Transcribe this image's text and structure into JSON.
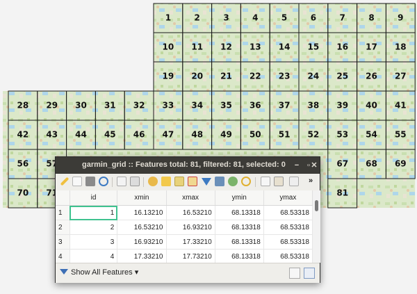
{
  "map": {
    "layer_name": "garmin_grid",
    "cells": [
      {
        "label": "1",
        "col": 5,
        "row": 0
      },
      {
        "label": "2",
        "col": 6,
        "row": 0
      },
      {
        "label": "3",
        "col": 7,
        "row": 0
      },
      {
        "label": "4",
        "col": 8,
        "row": 0
      },
      {
        "label": "5",
        "col": 9,
        "row": 0
      },
      {
        "label": "6",
        "col": 10,
        "row": 0
      },
      {
        "label": "7",
        "col": 11,
        "row": 0
      },
      {
        "label": "8",
        "col": 12,
        "row": 0
      },
      {
        "label": "9",
        "col": 13,
        "row": 0
      },
      {
        "label": "10",
        "col": 5,
        "row": 1
      },
      {
        "label": "11",
        "col": 6,
        "row": 1
      },
      {
        "label": "12",
        "col": 7,
        "row": 1
      },
      {
        "label": "13",
        "col": 8,
        "row": 1
      },
      {
        "label": "14",
        "col": 9,
        "row": 1
      },
      {
        "label": "15",
        "col": 10,
        "row": 1
      },
      {
        "label": "16",
        "col": 11,
        "row": 1
      },
      {
        "label": "17",
        "col": 12,
        "row": 1
      },
      {
        "label": "18",
        "col": 13,
        "row": 1
      },
      {
        "label": "19",
        "col": 5,
        "row": 2
      },
      {
        "label": "20",
        "col": 6,
        "row": 2
      },
      {
        "label": "21",
        "col": 7,
        "row": 2
      },
      {
        "label": "22",
        "col": 8,
        "row": 2
      },
      {
        "label": "23",
        "col": 9,
        "row": 2
      },
      {
        "label": "24",
        "col": 10,
        "row": 2
      },
      {
        "label": "25",
        "col": 11,
        "row": 2
      },
      {
        "label": "26",
        "col": 12,
        "row": 2
      },
      {
        "label": "27",
        "col": 13,
        "row": 2
      },
      {
        "label": "28",
        "col": 0,
        "row": 3
      },
      {
        "label": "29",
        "col": 1,
        "row": 3
      },
      {
        "label": "30",
        "col": 2,
        "row": 3
      },
      {
        "label": "31",
        "col": 3,
        "row": 3
      },
      {
        "label": "32",
        "col": 4,
        "row": 3
      },
      {
        "label": "33",
        "col": 5,
        "row": 3
      },
      {
        "label": "34",
        "col": 6,
        "row": 3
      },
      {
        "label": "35",
        "col": 7,
        "row": 3
      },
      {
        "label": "36",
        "col": 8,
        "row": 3
      },
      {
        "label": "37",
        "col": 9,
        "row": 3
      },
      {
        "label": "38",
        "col": 10,
        "row": 3
      },
      {
        "label": "39",
        "col": 11,
        "row": 3
      },
      {
        "label": "40",
        "col": 12,
        "row": 3
      },
      {
        "label": "41",
        "col": 13,
        "row": 3
      },
      {
        "label": "42",
        "col": 0,
        "row": 4
      },
      {
        "label": "43",
        "col": 1,
        "row": 4
      },
      {
        "label": "44",
        "col": 2,
        "row": 4
      },
      {
        "label": "45",
        "col": 3,
        "row": 4
      },
      {
        "label": "46",
        "col": 4,
        "row": 4
      },
      {
        "label": "47",
        "col": 5,
        "row": 4
      },
      {
        "label": "48",
        "col": 6,
        "row": 4
      },
      {
        "label": "49",
        "col": 7,
        "row": 4
      },
      {
        "label": "50",
        "col": 8,
        "row": 4
      },
      {
        "label": "51",
        "col": 9,
        "row": 4
      },
      {
        "label": "52",
        "col": 10,
        "row": 4
      },
      {
        "label": "53",
        "col": 11,
        "row": 4
      },
      {
        "label": "54",
        "col": 12,
        "row": 4
      },
      {
        "label": "55",
        "col": 13,
        "row": 4
      },
      {
        "label": "56",
        "col": 0,
        "row": 5
      },
      {
        "label": "57",
        "col": 1,
        "row": 5
      },
      {
        "label": "67",
        "col": 11,
        "row": 5
      },
      {
        "label": "68",
        "col": 12,
        "row": 5
      },
      {
        "label": "69",
        "col": 13,
        "row": 5
      },
      {
        "label": "70",
        "col": 0,
        "row": 6
      },
      {
        "label": "71",
        "col": 1,
        "row": 6
      },
      {
        "label": "81",
        "col": 11,
        "row": 6
      }
    ]
  },
  "dialog": {
    "title": "garmin_grid :: Features total: 81, filtered: 81, selected: 0",
    "min_glyph": "−",
    "max_glyph": "▫",
    "close_glyph": "✕",
    "overflow_glyph": "»",
    "columns": [
      "id",
      "xmin",
      "xmax",
      "ymin",
      "ymax"
    ],
    "rows": [
      {
        "n": "1",
        "id": "1",
        "xmin": "16.13210",
        "xmax": "16.53210",
        "ymin": "68.13318",
        "ymax": "68.53318"
      },
      {
        "n": "2",
        "id": "2",
        "xmin": "16.53210",
        "xmax": "16.93210",
        "ymin": "68.13318",
        "ymax": "68.53318"
      },
      {
        "n": "3",
        "id": "3",
        "xmin": "16.93210",
        "xmax": "17.33210",
        "ymin": "68.13318",
        "ymax": "68.53318"
      },
      {
        "n": "4",
        "id": "4",
        "xmin": "17.33210",
        "xmax": "17.73210",
        "ymin": "68.13318",
        "ymax": "68.53318"
      }
    ],
    "filter_label": "Show All Features",
    "filter_arrow": "▾"
  },
  "colors": {
    "map_land": "#d9e6c9",
    "map_water": "#a9d2ea",
    "grid_line": "#1a1a1a",
    "titlebar": "#3c3b37",
    "selection": "#3fc28f"
  }
}
